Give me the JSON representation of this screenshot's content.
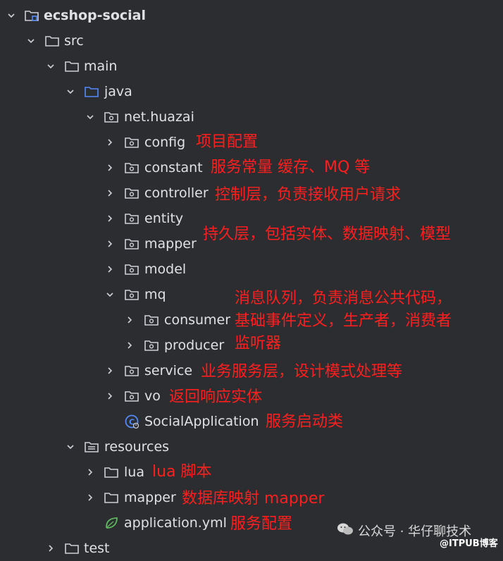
{
  "tree": {
    "root": "ecshop-social",
    "src": "src",
    "main": "main",
    "java": "java",
    "package": "net.huazai",
    "config": "config",
    "constant": "constant",
    "controller": "controller",
    "entity": "entity",
    "mapper": "mapper",
    "model": "model",
    "mq": "mq",
    "consumer": "consumer",
    "producer": "producer",
    "service": "service",
    "vo": "vo",
    "app": "SocialApplication",
    "resources": "resources",
    "lua": "lua",
    "res_mapper": "mapper",
    "yml": "application.yml",
    "test": "test"
  },
  "notes": {
    "config": "项目配置",
    "constant": "服务常量 缓存、MQ 等",
    "controller": "控制层，负责接收用户请求",
    "entity_mapper": "持久层，包括实体、数据映射、模型",
    "mq_line1": "消息队列，负责消息公共代码，",
    "mq_line2": "基础事件定义，生产者，消费者",
    "mq_line3": "监听器",
    "service": "业务服务层，设计模式处理等",
    "vo": "返回响应实体",
    "app": "服务启动类",
    "lua": "lua 脚本",
    "res_mapper": "数据库映射 mapper",
    "yml": "服务配置"
  },
  "watermark": {
    "text": "公众号 · 华仔聊技术",
    "site": "@ITPUB博客"
  },
  "colors": {
    "background": "#2b2d30",
    "text": "#dfe1e5",
    "annotation": "#ff1f1f",
    "icon": "#ced0d6",
    "source_folder": "#548af7",
    "app_icon": "#548af7",
    "yml_icon": "#5fb85f"
  }
}
